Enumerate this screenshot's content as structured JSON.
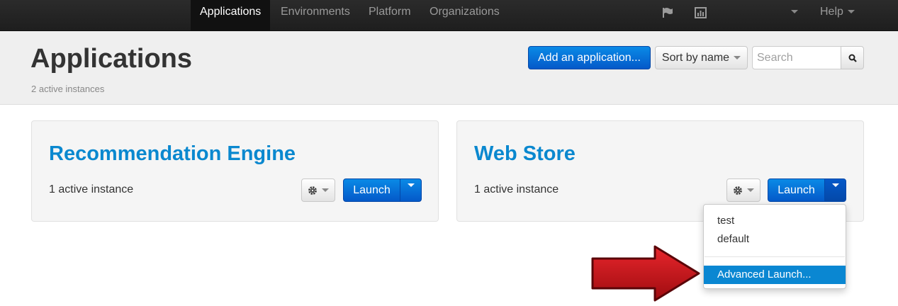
{
  "nav": {
    "items": [
      {
        "label": "Applications",
        "active": true
      },
      {
        "label": "Environments",
        "active": false
      },
      {
        "label": "Platform",
        "active": false
      },
      {
        "label": "Organizations",
        "active": false
      }
    ],
    "icons": [
      "flag-icon",
      "chart-icon"
    ],
    "help_label": "Help"
  },
  "header": {
    "title": "Applications",
    "subtitle": "2 active instances",
    "add_button": "Add an application...",
    "sort_button": "Sort by name",
    "search_placeholder": "Search"
  },
  "apps": [
    {
      "title": "Recommendation Engine",
      "instances": "1 active instance",
      "launch_label": "Launch"
    },
    {
      "title": "Web Store",
      "instances": "1 active instance",
      "launch_label": "Launch"
    }
  ],
  "launch_menu": {
    "items": [
      "test",
      "default"
    ],
    "advanced": "Advanced Launch..."
  },
  "colors": {
    "accent": "#0a88cf",
    "navbar": "#222222",
    "arrow": "#c0141a"
  }
}
